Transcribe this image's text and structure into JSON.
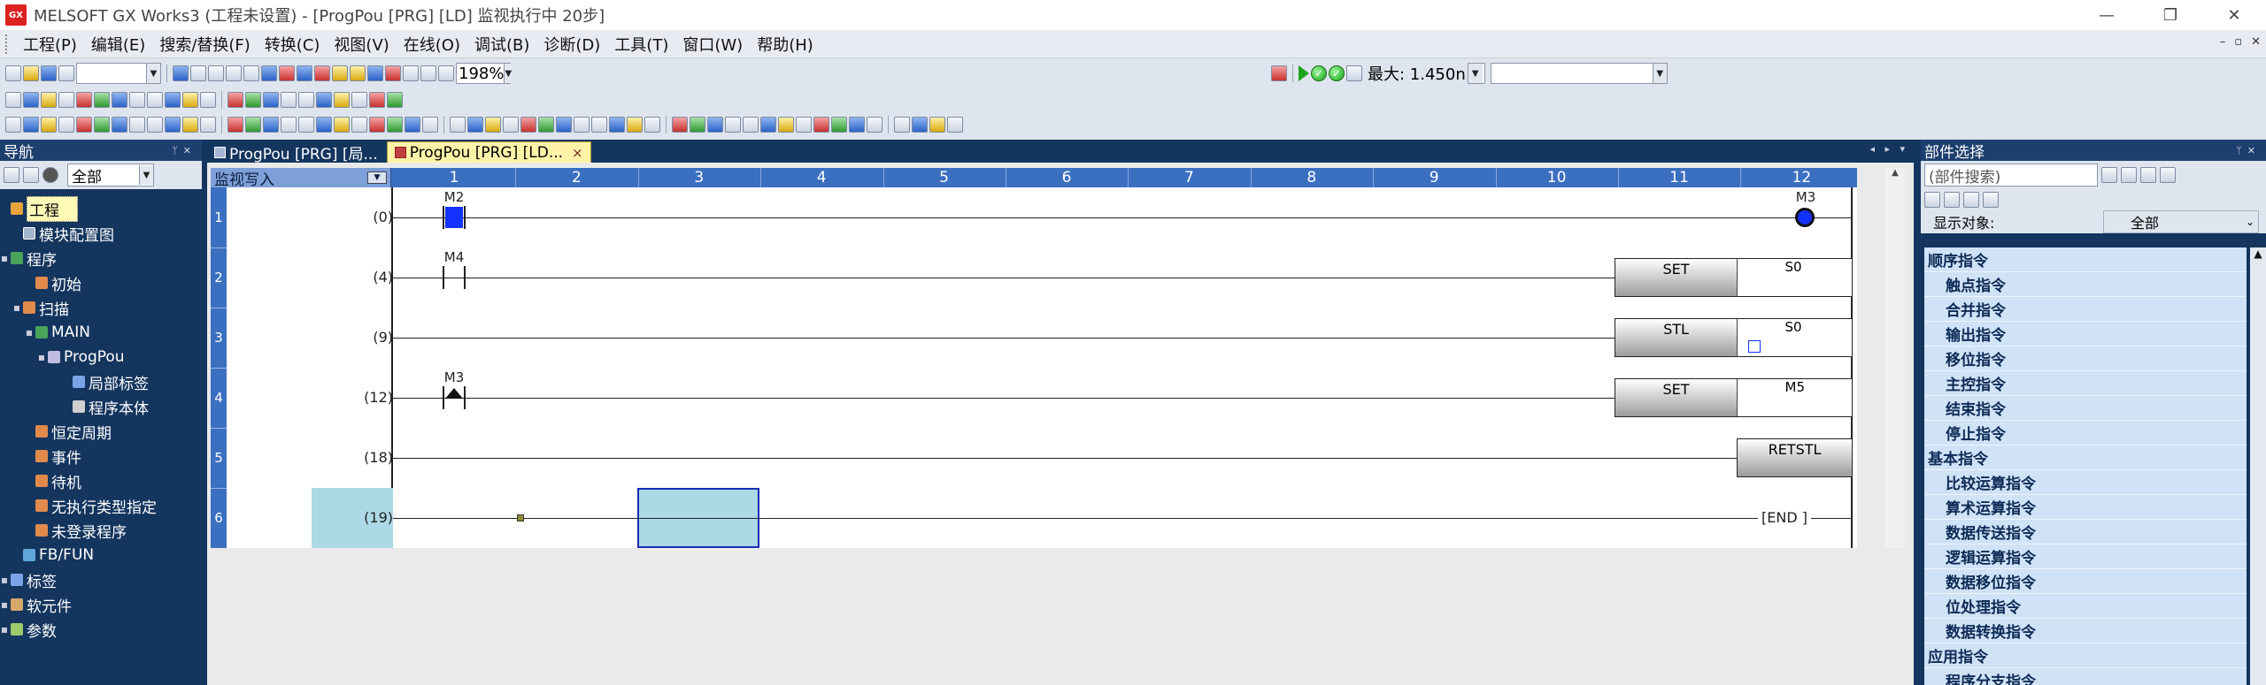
{
  "window": {
    "title": "MELSOFT GX Works3 (工程未设置) - [ProgPou [PRG] [LD] 监视执行中 20步]",
    "logo_text": "GX",
    "min_icon": "—",
    "restore_icon": "❐",
    "close_icon": "✕"
  },
  "menu": {
    "items": [
      "工程(P)",
      "编辑(E)",
      "搜索/替换(F)",
      "转换(C)",
      "视图(V)",
      "在线(O)",
      "调试(B)",
      "诊断(D)",
      "工具(T)",
      "窗口(W)",
      "帮助(H)"
    ],
    "mdi_controls": [
      "–",
      "▫",
      "✕"
    ]
  },
  "toolbar": {
    "zoom": "198%",
    "max_label": "最大: 1.450n",
    "status_combo": ""
  },
  "nav": {
    "title": "导航",
    "filter": "全部",
    "items": [
      {
        "label": "工程",
        "indent": 0,
        "twisty": "",
        "icon": "proj",
        "selected": true
      },
      {
        "label": "模块配置图",
        "indent": 1,
        "twisty": "",
        "icon": "mod"
      },
      {
        "label": "程序",
        "indent": 0,
        "twisty": "▪",
        "icon": "prog"
      },
      {
        "label": "初始",
        "indent": 2,
        "twisty": "",
        "icon": "task"
      },
      {
        "label": "扫描",
        "indent": 1,
        "twisty": "▪",
        "icon": "task"
      },
      {
        "label": "MAIN",
        "indent": 2,
        "twisty": "▪",
        "icon": "prog"
      },
      {
        "label": "ProgPou",
        "indent": 3,
        "twisty": "▪",
        "icon": "pou"
      },
      {
        "label": "局部标签",
        "indent": 5,
        "twisty": "",
        "icon": "label"
      },
      {
        "label": "程序本体",
        "indent": 5,
        "twisty": "",
        "icon": "body"
      },
      {
        "label": "恒定周期",
        "indent": 2,
        "twisty": "",
        "icon": "task"
      },
      {
        "label": "事件",
        "indent": 2,
        "twisty": "",
        "icon": "task"
      },
      {
        "label": "待机",
        "indent": 2,
        "twisty": "",
        "icon": "task"
      },
      {
        "label": "无执行类型指定",
        "indent": 2,
        "twisty": "",
        "icon": "task"
      },
      {
        "label": "未登录程序",
        "indent": 2,
        "twisty": "",
        "icon": "task"
      },
      {
        "label": "FB/FUN",
        "indent": 1,
        "twisty": "",
        "icon": "fb"
      },
      {
        "label": "标签",
        "indent": 0,
        "twisty": "▪",
        "icon": "label"
      },
      {
        "label": "软元件",
        "indent": 0,
        "twisty": "▪",
        "icon": "dev"
      },
      {
        "label": "参数",
        "indent": 0,
        "twisty": "▪",
        "icon": "param"
      }
    ]
  },
  "tabs": [
    {
      "label": "ProgPou [PRG] [局...",
      "active": false
    },
    {
      "label": "ProgPou [PRG] [LD...",
      "active": true,
      "close": "×"
    }
  ],
  "tab_nav": "◂ ▸ ▾",
  "ladder": {
    "mode": "监视写入",
    "columns": [
      "1",
      "2",
      "3",
      "4",
      "5",
      "6",
      "7",
      "8",
      "9",
      "10",
      "11",
      "12"
    ],
    "rows": [
      {
        "num": "1",
        "step": "(0)"
      },
      {
        "num": "2",
        "step": "(4)"
      },
      {
        "num": "3",
        "step": "(9)"
      },
      {
        "num": "4",
        "step": "(12)"
      },
      {
        "num": "5",
        "step": "(18)"
      },
      {
        "num": "6",
        "step": "(19)"
      }
    ],
    "devices": {
      "r1_contact": "M2",
      "r1_coil": "M3",
      "r2_contact": "M4",
      "r2_instr": "SET",
      "r2_operand": "S0",
      "r3_instr": "STL",
      "r3_operand": "S0",
      "r4_contact": "M3",
      "r4_instr": "SET",
      "r4_operand": "M5",
      "r5_instr": "RETSTL",
      "r6_end": "[END    ]"
    }
  },
  "parts": {
    "title": "部件选择",
    "search_placeholder": "(部件搜索)",
    "filter_label": "显示对象:",
    "filter_value": "全部",
    "list": [
      {
        "label": "顺序指令",
        "type": "cat"
      },
      {
        "label": "触点指令",
        "type": "sub"
      },
      {
        "label": "合并指令",
        "type": "sub"
      },
      {
        "label": "输出指令",
        "type": "sub"
      },
      {
        "label": "移位指令",
        "type": "sub"
      },
      {
        "label": "主控指令",
        "type": "sub"
      },
      {
        "label": "结束指令",
        "type": "sub"
      },
      {
        "label": "停止指令",
        "type": "sub"
      },
      {
        "label": "基本指令",
        "type": "cat"
      },
      {
        "label": "比较运算指令",
        "type": "sub"
      },
      {
        "label": "算术运算指令",
        "type": "sub"
      },
      {
        "label": "数据传送指令",
        "type": "sub"
      },
      {
        "label": "逻辑运算指令",
        "type": "sub"
      },
      {
        "label": "数据移位指令",
        "type": "sub"
      },
      {
        "label": "位处理指令",
        "type": "sub"
      },
      {
        "label": "数据转换指令",
        "type": "sub"
      },
      {
        "label": "应用指令",
        "type": "cat"
      },
      {
        "label": "程序分支指令",
        "type": "sub"
      }
    ]
  }
}
